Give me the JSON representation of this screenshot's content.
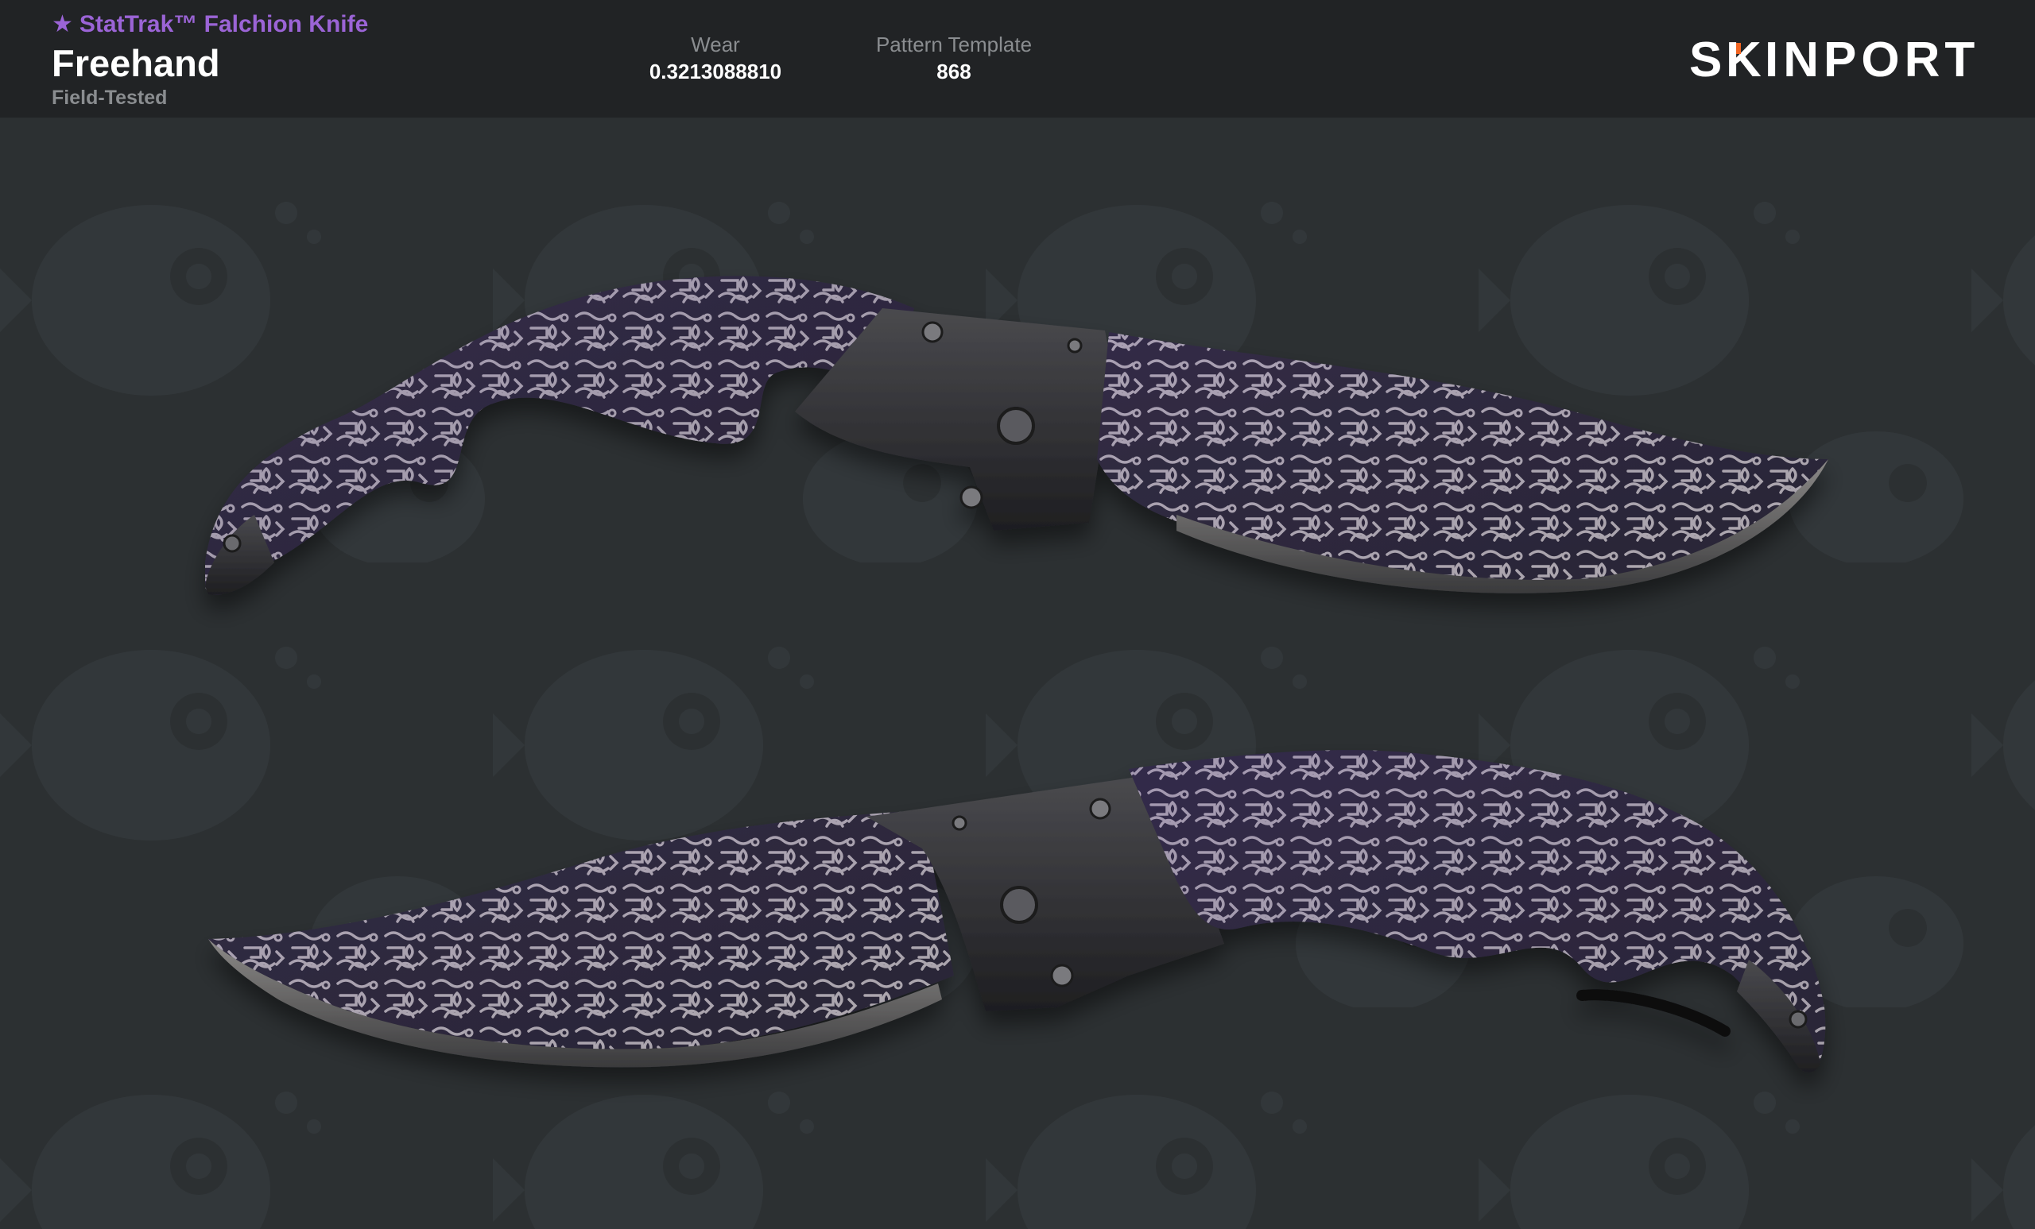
{
  "header": {
    "item_type": "StatTrak™ Falchion Knife",
    "star_icon": "★",
    "item_name": "Freehand",
    "exterior": "Field-Tested",
    "wear": {
      "label": "Wear",
      "value": "0.3213088810"
    },
    "pattern": {
      "label": "Pattern Template",
      "value": "868"
    },
    "brand": {
      "logo_text": "SKINPORT",
      "logo_accent_color": "#f26522"
    }
  },
  "colors": {
    "accent_purple": "#9b64d6",
    "header_bg": "#212325",
    "page_bg": "#2c3032",
    "knife_purple": "#3b2472"
  },
  "images": {
    "knife_top": "falchion-knife-side-a",
    "knife_bottom": "falchion-knife-side-b",
    "background": "fish-skull-watermark-pattern"
  }
}
